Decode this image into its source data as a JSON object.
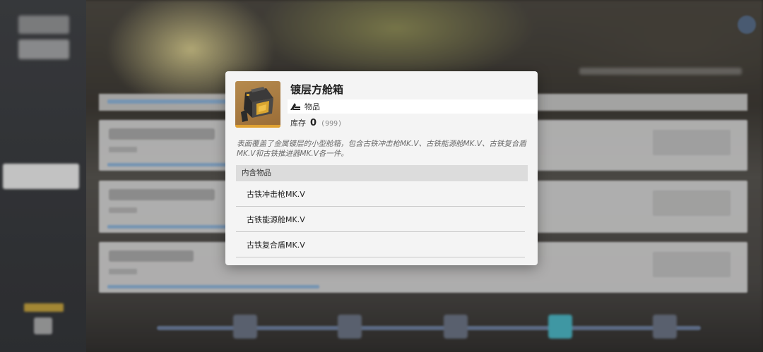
{
  "popup": {
    "item_name": "镀层方舱箱",
    "item_type": "物品",
    "stock_label": "库存",
    "stock_count": "0",
    "stock_max": "(999)",
    "description": "表面覆盖了金属镀层的小型舱箱，包含古铁冲击枪MK.V、古铁能源舱MK.V、古铁复合盾MK.V和古铁推进器MK.V各一件。",
    "contents_header": "内含物品",
    "contents": [
      {
        "name": "古铁冲击枪MK.V"
      },
      {
        "name": "古铁能源舱MK.V"
      },
      {
        "name": "古铁复合盾MK.V"
      }
    ],
    "icons": {
      "item_thumbnail": "armored-case-icon",
      "type": "item-category-icon"
    },
    "colors": {
      "rarity": "#e0a232",
      "thumbnail_bg": "#b58a4e"
    }
  }
}
